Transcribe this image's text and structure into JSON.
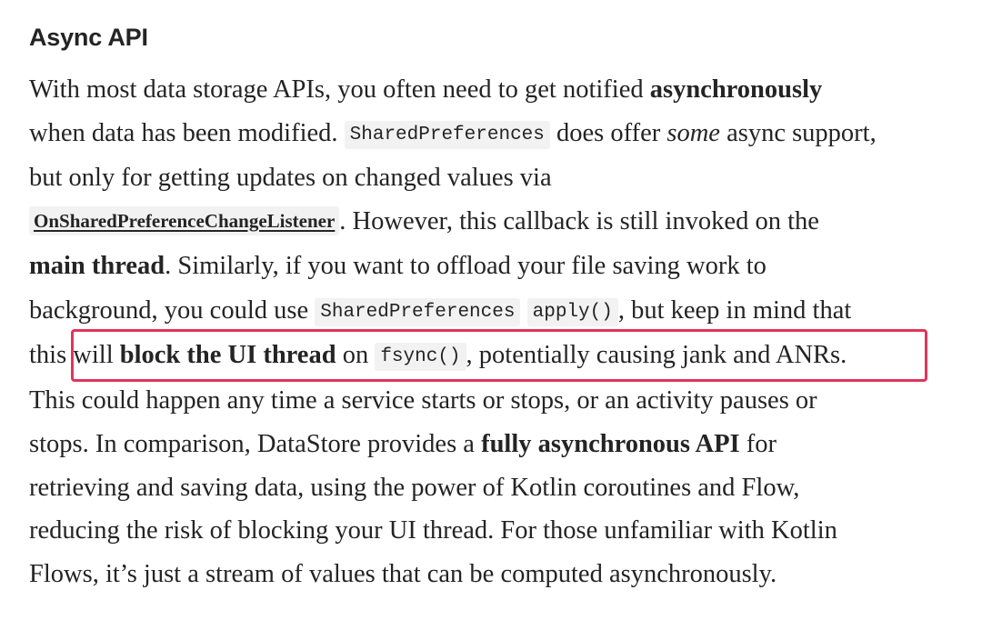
{
  "article": {
    "heading": "Async API",
    "paragraph": {
      "l1": {
        "t1": "With most data storage APIs, you often need to get notified ",
        "b1": "asynchronously"
      },
      "l2": {
        "t1": "when data has been modified. ",
        "c1": "SharedPreferences",
        "t2": " does offer ",
        "i1": "some",
        "t3": " async support,"
      },
      "l3": {
        "t1": "but only for getting updates on changed values via"
      },
      "l4": {
        "link1": "OnSharedPreferenceChangeListener",
        "t1": ". However, this callback is still invoked on the"
      },
      "l5": {
        "b1": "main thread",
        "t1": ". Similarly, if you want to offload your file saving work to"
      },
      "l6": {
        "t1": "background, you could use ",
        "c1": "SharedPreferences",
        "c2": "apply()",
        "t2": ", but keep in mind that"
      },
      "l7": {
        "t1": "this will ",
        "b1": "block the UI thread",
        "t2": " on ",
        "c1": "fsync()",
        "t3": ", potentially causing jank and ANRs."
      },
      "l8": {
        "t1": "This could happen any time a service starts or stops, or an activity pauses or"
      },
      "l9": {
        "t1": "stops. In comparison, DataStore provides a ",
        "b1": "fully asynchronous API",
        "t2": " for"
      },
      "l10": {
        "t1": "retrieving and saving data, using the power of Kotlin coroutines and Flow,"
      },
      "l11": {
        "t1": "reducing the risk of blocking your UI thread. For those unfamiliar with Kotlin"
      },
      "l12": {
        "t1": "Flows, it’s just a stream of values that can be computed asynchronously."
      }
    }
  },
  "colors": {
    "text": "#242424",
    "code_background": "#f2f2f2",
    "highlight_border": "#e0345c"
  }
}
